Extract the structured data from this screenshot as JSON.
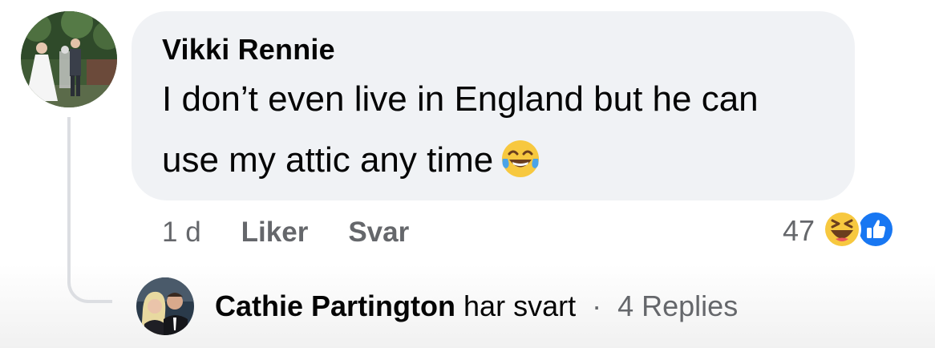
{
  "comment": {
    "author": "Vikki Rennie",
    "text_line1": "I don’t even live in England but he can",
    "text_line2": "use my attic any time",
    "inline_emoji": "face-with-tears-of-joy-icon",
    "time": "1 d",
    "like_label": "Liker",
    "reply_label": "Svar",
    "reaction_count": "47",
    "reactions": [
      "haha-reaction-icon",
      "like-reaction-icon"
    ]
  },
  "reply_summary": {
    "name": "Cathie Partington",
    "verb": "har svart",
    "separator": "·",
    "count_label": "4 Replies"
  },
  "colors": {
    "bubble": "#f0f2f5",
    "secondary_text": "#65676b",
    "like_blue": "#1877f2",
    "haha_yellow": "#f7c83f"
  }
}
